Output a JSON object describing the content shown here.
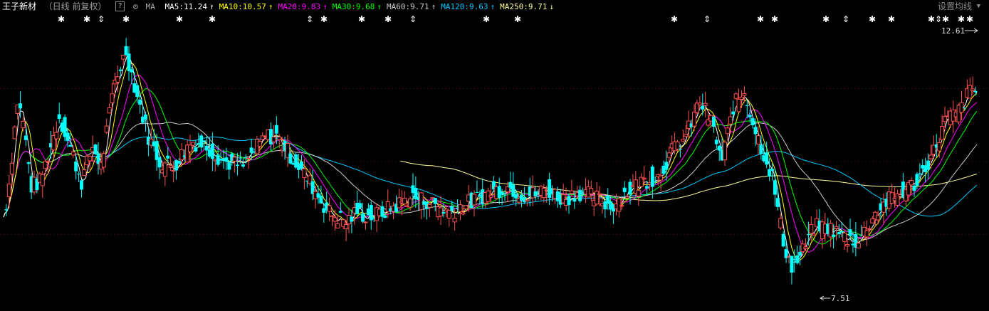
{
  "header": {
    "title": "王子新材",
    "period": "（日线 前复权）",
    "help": "?",
    "ma_label": "MA",
    "settings_label": "设置均线",
    "ma_items": [
      {
        "label": "MA5:11.24",
        "arrow": "↑",
        "color": "#ffffff"
      },
      {
        "label": "MA10:10.57",
        "arrow": "↑",
        "color": "#ffff00"
      },
      {
        "label": "MA20:9.83",
        "arrow": "↑",
        "color": "#ff00ff"
      },
      {
        "label": "MA30:9.68",
        "arrow": "↑",
        "color": "#00ff00"
      },
      {
        "label": "MA60:9.71",
        "arrow": "↑",
        "color": "#cccccc"
      },
      {
        "label": "MA120:9.63",
        "arrow": "↑",
        "color": "#00c8ff"
      },
      {
        "label": "MA250:9.71",
        "arrow": "↓",
        "color": "#ffff99"
      }
    ]
  },
  "chart_data": {
    "type": "candlestick",
    "ylim": [
      7.2,
      13.0
    ],
    "high_label": "12.61",
    "low_label": "7.51",
    "colors": {
      "up": "#ff5050",
      "down": "#00ffff",
      "ma5": "#ffffff",
      "ma10": "#ffff00",
      "ma20": "#ff00ff",
      "ma30": "#00ff00",
      "ma60": "#cccccc",
      "ma120": "#00c8ff",
      "ma250": "#ffff99"
    },
    "key_points": [
      [
        0,
        9.0
      ],
      [
        3,
        9.4
      ],
      [
        10,
        11.3
      ],
      [
        14,
        10.9
      ],
      [
        20,
        9.6
      ],
      [
        26,
        9.7
      ],
      [
        33,
        10.3
      ],
      [
        40,
        11.0
      ],
      [
        50,
        10.2
      ],
      [
        56,
        9.7
      ],
      [
        64,
        10.4
      ],
      [
        70,
        10.0
      ],
      [
        80,
        11.7
      ],
      [
        88,
        12.3
      ],
      [
        95,
        11.5
      ],
      [
        104,
        10.6
      ],
      [
        112,
        10.1
      ],
      [
        122,
        10.0
      ],
      [
        135,
        10.5
      ],
      [
        146,
        10.4
      ],
      [
        158,
        10.1
      ],
      [
        172,
        10.0
      ],
      [
        180,
        10.3
      ],
      [
        188,
        10.6
      ],
      [
        196,
        10.6
      ],
      [
        204,
        10.3
      ],
      [
        212,
        10.0
      ],
      [
        222,
        9.6
      ],
      [
        233,
        9.1
      ],
      [
        246,
        8.9
      ],
      [
        254,
        9.1
      ],
      [
        262,
        9.0
      ],
      [
        270,
        9.05
      ],
      [
        280,
        9.2
      ],
      [
        292,
        9.4
      ],
      [
        306,
        9.3
      ],
      [
        320,
        9.1
      ],
      [
        336,
        9.3
      ],
      [
        350,
        9.5
      ],
      [
        362,
        9.6
      ],
      [
        376,
        9.4
      ],
      [
        390,
        9.55
      ],
      [
        402,
        9.35
      ],
      [
        412,
        9.5
      ],
      [
        424,
        9.4
      ],
      [
        436,
        9.2
      ],
      [
        446,
        9.45
      ],
      [
        458,
        9.7
      ],
      [
        470,
        9.8
      ],
      [
        480,
        10.3
      ],
      [
        490,
        10.6
      ],
      [
        500,
        11.3
      ],
      [
        508,
        10.9
      ],
      [
        516,
        10.1
      ],
      [
        524,
        11.2
      ],
      [
        532,
        11.5
      ],
      [
        540,
        10.7
      ],
      [
        552,
        9.8
      ],
      [
        560,
        8.5
      ],
      [
        566,
        8.0
      ],
      [
        572,
        8.2
      ],
      [
        582,
        8.8
      ],
      [
        592,
        8.8
      ],
      [
        604,
        8.6
      ],
      [
        614,
        8.5
      ],
      [
        624,
        9.0
      ],
      [
        634,
        9.3
      ],
      [
        646,
        9.5
      ],
      [
        656,
        9.7
      ],
      [
        668,
        10.3
      ],
      [
        676,
        10.9
      ],
      [
        686,
        11.1
      ],
      [
        694,
        11.5
      ]
    ],
    "markers": [
      86,
      122,
      142,
      177,
      252,
      298,
      435,
      455,
      508,
      545,
      580,
      683,
      727,
      947,
      993,
      1068,
      1088,
      1160,
      1188,
      1225,
      1252,
      1308,
      1318,
      1328,
      1350,
      1362
    ]
  }
}
